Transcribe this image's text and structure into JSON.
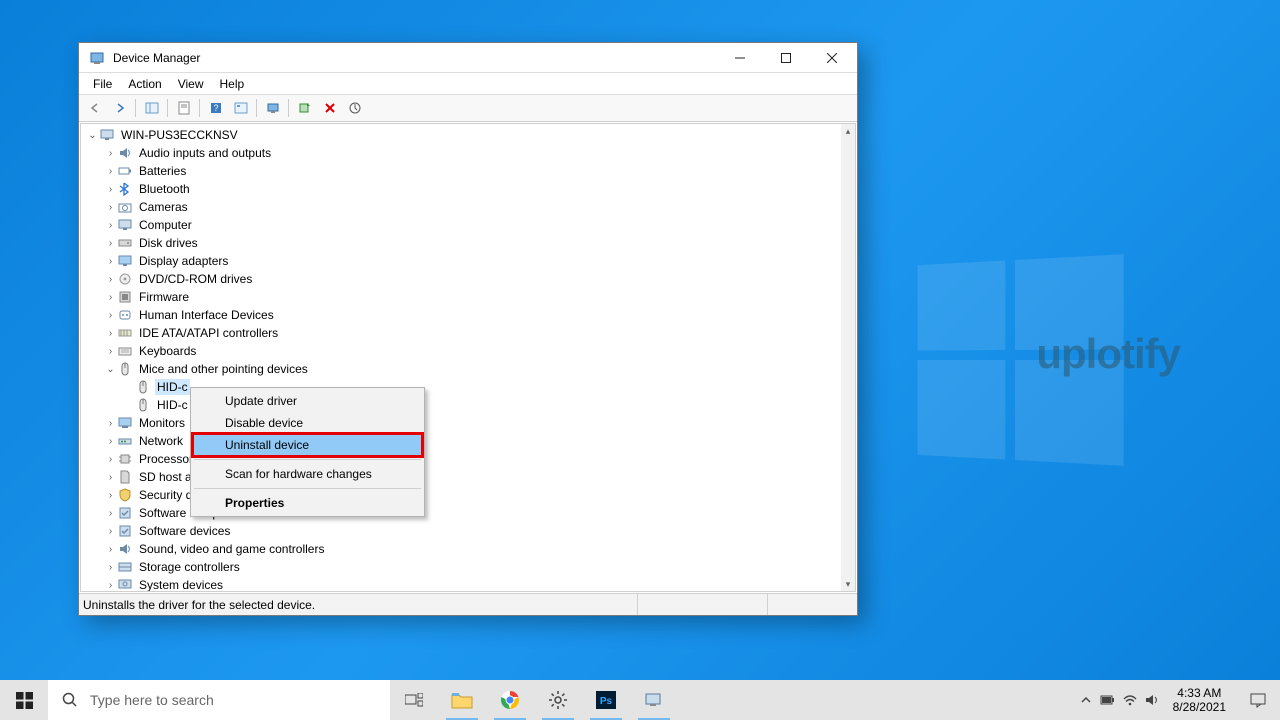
{
  "window": {
    "title": "Device Manager",
    "menu": [
      "File",
      "Action",
      "View",
      "Help"
    ],
    "status": "Uninstalls the driver for the selected device."
  },
  "tree": {
    "root": "WIN-PUS3ECCKNSV",
    "items": [
      {
        "label": "Audio inputs and outputs",
        "icon": "audio"
      },
      {
        "label": "Batteries",
        "icon": "battery"
      },
      {
        "label": "Bluetooth",
        "icon": "bluetooth"
      },
      {
        "label": "Cameras",
        "icon": "camera"
      },
      {
        "label": "Computer",
        "icon": "computer"
      },
      {
        "label": "Disk drives",
        "icon": "disk"
      },
      {
        "label": "Display adapters",
        "icon": "display"
      },
      {
        "label": "DVD/CD-ROM drives",
        "icon": "dvd"
      },
      {
        "label": "Firmware",
        "icon": "firmware"
      },
      {
        "label": "Human Interface Devices",
        "icon": "hid"
      },
      {
        "label": "IDE ATA/ATAPI controllers",
        "icon": "ide"
      },
      {
        "label": "Keyboards",
        "icon": "keyboard"
      },
      {
        "label": "Mice and other pointing devices",
        "icon": "mouse",
        "expanded": true,
        "children": [
          {
            "label": "HID-c",
            "icon": "mouse",
            "selected": true
          },
          {
            "label": "HID-c",
            "icon": "mouse"
          }
        ]
      },
      {
        "label": "Monitors",
        "icon": "monitor"
      },
      {
        "label": "Network",
        "icon": "network"
      },
      {
        "label": "Processor",
        "icon": "cpu"
      },
      {
        "label": "SD host a",
        "icon": "sd"
      },
      {
        "label": "Security d",
        "icon": "security"
      },
      {
        "label": "Software components",
        "icon": "sw"
      },
      {
        "label": "Software devices",
        "icon": "sw"
      },
      {
        "label": "Sound, video and game controllers",
        "icon": "audio"
      },
      {
        "label": "Storage controllers",
        "icon": "storage"
      },
      {
        "label": "System devices",
        "icon": "system"
      }
    ]
  },
  "context_menu": {
    "items": [
      {
        "label": "Update driver"
      },
      {
        "label": "Disable device"
      },
      {
        "label": "Uninstall device",
        "highlight": true,
        "redbox": true
      },
      {
        "sep": true
      },
      {
        "label": "Scan for hardware changes"
      },
      {
        "sep": true
      },
      {
        "label": "Properties",
        "bold": true
      }
    ]
  },
  "taskbar": {
    "search_placeholder": "Type here to search",
    "time": "4:33 AM",
    "date": "8/28/2021"
  },
  "watermark": "uplotify"
}
